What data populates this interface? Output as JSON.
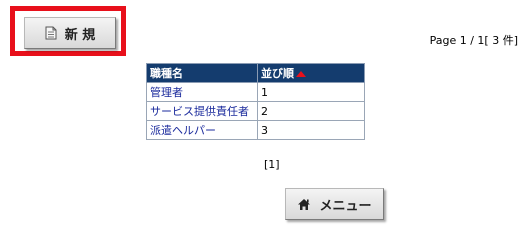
{
  "toolbar": {
    "new_label": "新 規",
    "new_icon": "document-icon"
  },
  "pagination": {
    "info": "Page 1 / 1[ 3 件]",
    "pages": [
      "[1]"
    ]
  },
  "table": {
    "headers": [
      "職種名",
      "並び順"
    ],
    "sort_indicator": "sort-ascending-arrow",
    "rows": [
      {
        "name": "管理者",
        "order": "1"
      },
      {
        "name": "サービス提供責任者",
        "order": "2"
      },
      {
        "name": "派遣ヘルパー",
        "order": "3"
      }
    ]
  },
  "footer": {
    "menu_label": "メニュー",
    "menu_icon": "home-icon"
  },
  "colors": {
    "highlight": "#e8101b",
    "header_bg": "#143c6e",
    "link_text": "#1a2a9c"
  }
}
